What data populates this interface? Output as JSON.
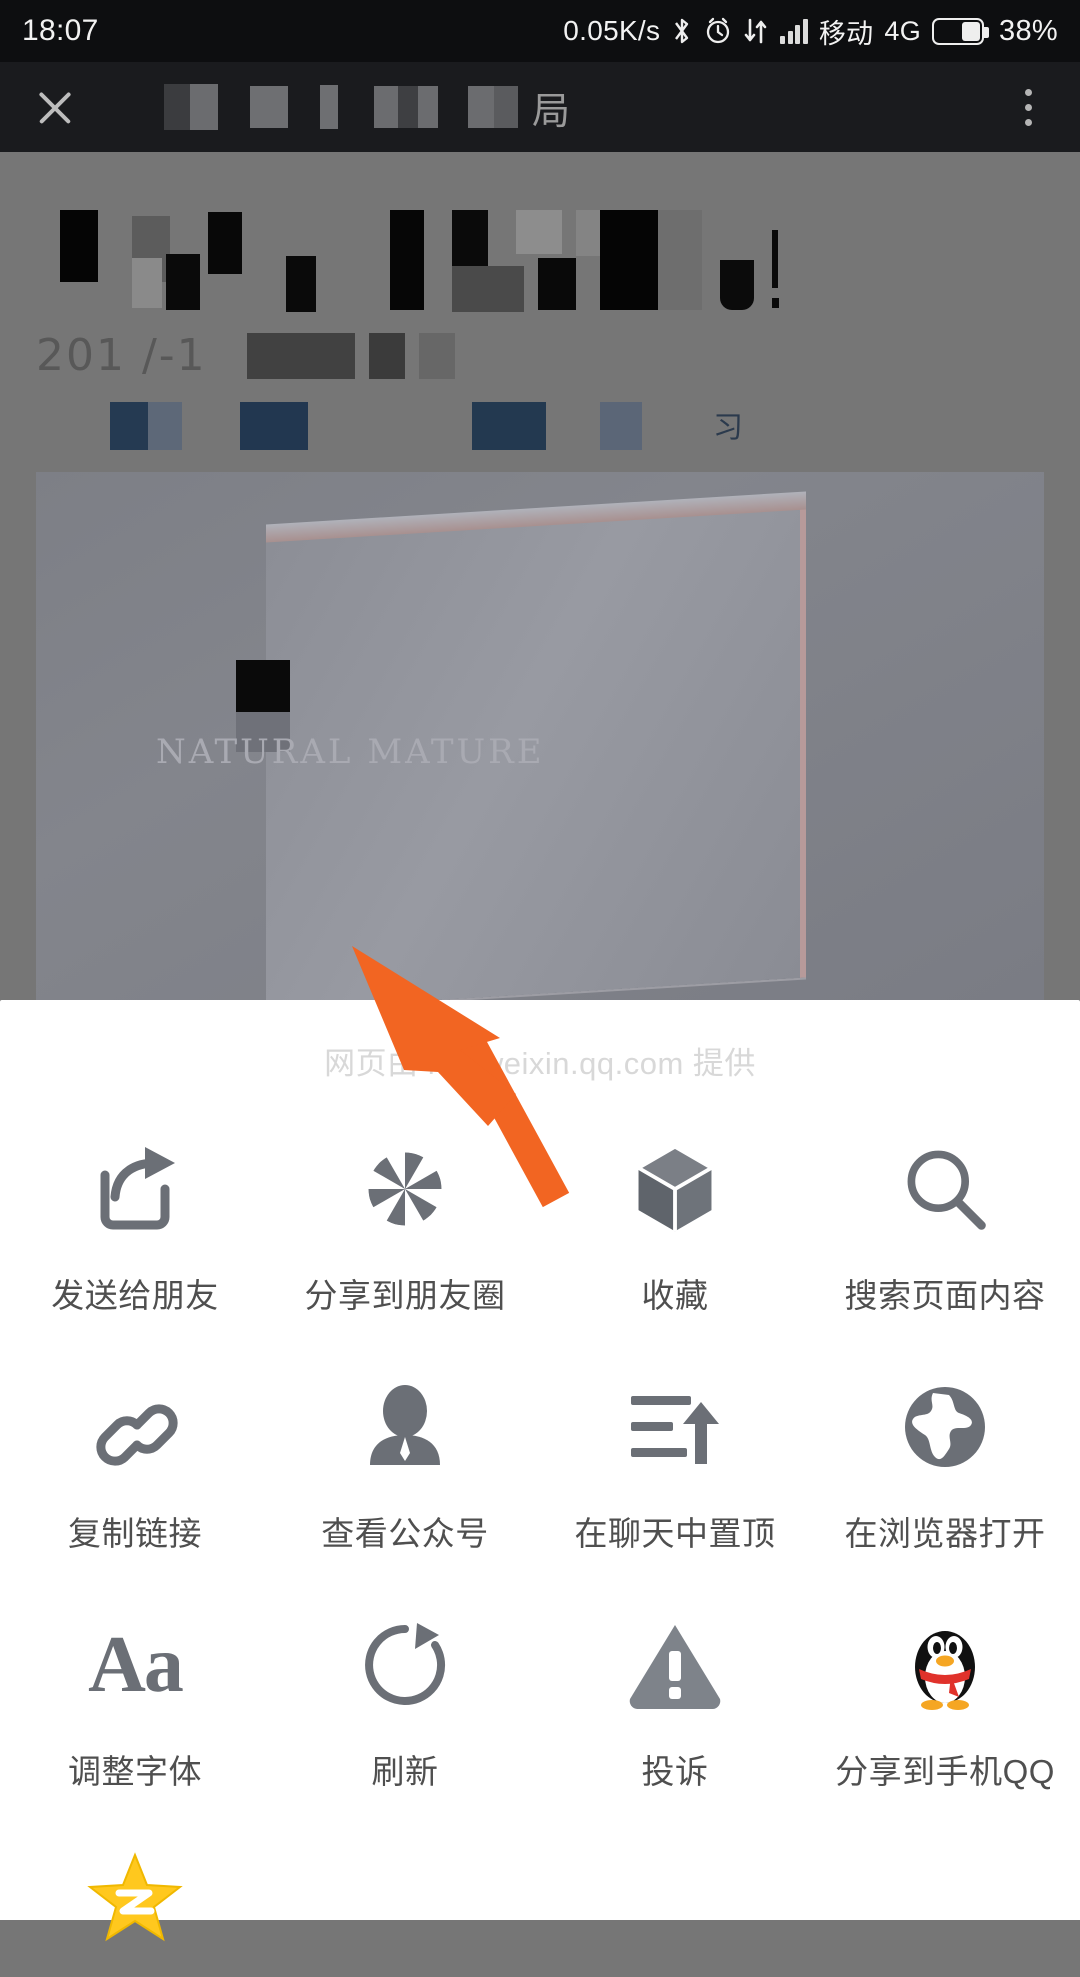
{
  "statusbar": {
    "time": "18:07",
    "network_speed": "0.05K/s",
    "bluetooth_icon": "bluetooth-icon",
    "alarm_icon": "alarm-icon",
    "data_transfer_icon": "data-transfer-icon",
    "signal_icon": "signal-bars-icon",
    "carrier": "移动",
    "network_type": "4G",
    "battery_icon": "battery-icon",
    "battery_percent": "38%"
  },
  "titlebar": {
    "close_icon": "close-icon",
    "title_redacted": "",
    "title_glyph": "局",
    "more_icon": "more-options-icon"
  },
  "article": {
    "title_redacted": "",
    "date_visible": "201 /-1",
    "caption_glyph": "习",
    "image_caption": "NATURAL MATURE"
  },
  "sheet": {
    "header": "网页由 mp.weixin.qq.com 提供",
    "rows": [
      [
        {
          "icon": "share-forward-icon",
          "label": "发送给朋友"
        },
        {
          "icon": "aperture-icon",
          "label": "分享到朋友圈"
        },
        {
          "icon": "cube-favorite-icon",
          "label": "收藏"
        },
        {
          "icon": "search-icon",
          "label": "搜索页面内容"
        }
      ],
      [
        {
          "icon": "link-chain-icon",
          "label": "复制链接"
        },
        {
          "icon": "person-icon",
          "label": "查看公众号"
        },
        {
          "icon": "pin-to-top-icon",
          "label": "在聊天中置顶"
        },
        {
          "icon": "globe-icon",
          "label": "在浏览器打开"
        }
      ],
      [
        {
          "icon": "font-size-icon",
          "label": "调整字体"
        },
        {
          "icon": "refresh-icon",
          "label": "刷新"
        },
        {
          "icon": "warning-icon",
          "label": "投诉"
        },
        {
          "icon": "qq-penguin-icon",
          "label": "分享到手机QQ"
        }
      ],
      [
        {
          "icon": "qzone-star-icon",
          "label": ""
        }
      ]
    ]
  },
  "annotation": {
    "arrow_icon": "pointer-arrow-icon",
    "arrow_color": "#F26522",
    "points_at": "分享到朋友圈"
  },
  "colors": {
    "status_bar_bg": "#0d0e10",
    "title_bar_bg": "#1a1b1e",
    "dim_overlay": "#767676",
    "sheet_bg": "#ffffff",
    "icon_gray": "#6b6f76",
    "label_gray": "#4f4f4f",
    "header_gray": "#d8d8d8",
    "accent_orange": "#F26522",
    "qzone_yellow": "#FFCC00"
  }
}
